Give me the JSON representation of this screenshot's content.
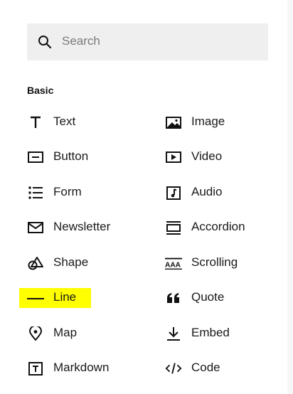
{
  "search": {
    "placeholder": "Search",
    "icon": "search-icon"
  },
  "section": {
    "title": "Basic"
  },
  "highlight_color": "#ffff00",
  "items_left": [
    {
      "label": "Text",
      "icon": "text-icon"
    },
    {
      "label": "Button",
      "icon": "button-icon"
    },
    {
      "label": "Form",
      "icon": "form-icon"
    },
    {
      "label": "Newsletter",
      "icon": "envelope-icon"
    },
    {
      "label": "Shape",
      "icon": "shape-icon"
    },
    {
      "label": "Line",
      "icon": "line-icon",
      "highlighted": true
    },
    {
      "label": "Map",
      "icon": "map-pin-icon"
    },
    {
      "label": "Markdown",
      "icon": "markdown-icon"
    }
  ],
  "items_right": [
    {
      "label": "Image",
      "icon": "image-icon"
    },
    {
      "label": "Video",
      "icon": "video-icon"
    },
    {
      "label": "Audio",
      "icon": "audio-icon"
    },
    {
      "label": "Accordion",
      "icon": "accordion-icon"
    },
    {
      "label": "Scrolling",
      "icon": "scrolling-icon"
    },
    {
      "label": "Quote",
      "icon": "quote-icon"
    },
    {
      "label": "Embed",
      "icon": "embed-icon"
    },
    {
      "label": "Code",
      "icon": "code-icon"
    }
  ]
}
